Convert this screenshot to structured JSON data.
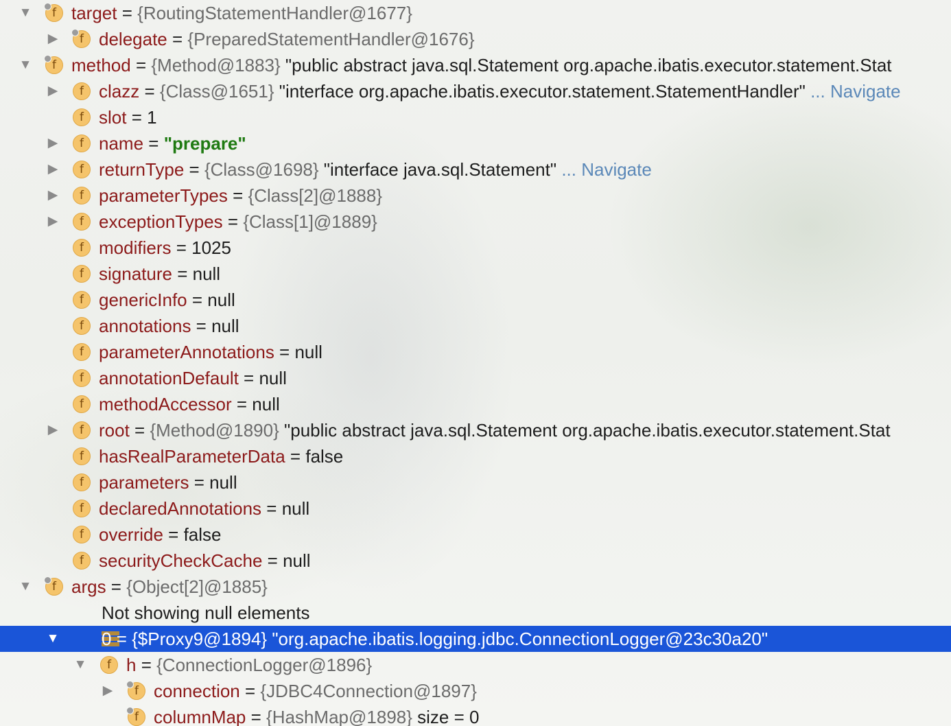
{
  "colors": {
    "selection": "#1a55d8",
    "field_name": "#8c1a1a",
    "type_ref": "#6b6b6b",
    "string_literal": "#1f7a12",
    "navigate_link": "#5b88b8",
    "field_icon": "#f5c46b"
  },
  "icons": {
    "field": "field-f-icon",
    "static_field": "field-f-pinned-icon",
    "array": "array-icon",
    "expanded": "triangle-down",
    "collapsed": "triangle-right"
  },
  "rows": [
    {
      "arrow": "▼",
      "icon": "f",
      "pinned": true,
      "name": "target",
      "eq": " = ",
      "type": "{RoutingStatementHandler@1677}",
      "value": "",
      "navigate": ""
    },
    {
      "arrow": "▶",
      "icon": "f",
      "pinned": true,
      "name": "delegate",
      "eq": " = ",
      "type": "{PreparedStatementHandler@1676}",
      "value": "",
      "navigate": ""
    },
    {
      "arrow": "▼",
      "icon": "f",
      "pinned": true,
      "name": "method",
      "eq": " = ",
      "type": "{Method@1883}",
      "value": " \"public abstract java.sql.Statement org.apache.ibatis.executor.statement.Stat",
      "navigate": ""
    },
    {
      "arrow": "▶",
      "icon": "f",
      "pinned": false,
      "name": "clazz",
      "eq": " = ",
      "type": "{Class@1651}",
      "value": " \"interface org.apache.ibatis.executor.statement.StatementHandler\"",
      "navigate": " ... Navigate"
    },
    {
      "arrow": "",
      "icon": "f",
      "pinned": false,
      "name": "slot",
      "eq": " = ",
      "type": "",
      "value": "1",
      "navigate": ""
    },
    {
      "arrow": "▶",
      "icon": "f",
      "pinned": false,
      "name": "name",
      "eq": " = ",
      "type": "",
      "value": "",
      "green": "\"prepare\"",
      "navigate": ""
    },
    {
      "arrow": "▶",
      "icon": "f",
      "pinned": false,
      "name": "returnType",
      "eq": " = ",
      "type": "{Class@1698}",
      "value": " \"interface java.sql.Statement\"",
      "navigate": " ... Navigate"
    },
    {
      "arrow": "▶",
      "icon": "f",
      "pinned": false,
      "name": "parameterTypes",
      "eq": " = ",
      "type": "{Class[2]@1888}",
      "value": "",
      "navigate": ""
    },
    {
      "arrow": "▶",
      "icon": "f",
      "pinned": false,
      "name": "exceptionTypes",
      "eq": " = ",
      "type": "{Class[1]@1889}",
      "value": "",
      "navigate": ""
    },
    {
      "arrow": "",
      "icon": "f",
      "pinned": false,
      "name": "modifiers",
      "eq": " = ",
      "type": "",
      "value": "1025",
      "navigate": ""
    },
    {
      "arrow": "",
      "icon": "f",
      "pinned": false,
      "name": "signature",
      "eq": " = ",
      "type": "",
      "value": "null",
      "navigate": ""
    },
    {
      "arrow": "",
      "icon": "f",
      "pinned": false,
      "name": "genericInfo",
      "eq": " = ",
      "type": "",
      "value": "null",
      "navigate": ""
    },
    {
      "arrow": "",
      "icon": "f",
      "pinned": false,
      "name": "annotations",
      "eq": " = ",
      "type": "",
      "value": "null",
      "navigate": ""
    },
    {
      "arrow": "",
      "icon": "f",
      "pinned": false,
      "name": "parameterAnnotations",
      "eq": " = ",
      "type": "",
      "value": "null",
      "navigate": ""
    },
    {
      "arrow": "",
      "icon": "f",
      "pinned": false,
      "name": "annotationDefault",
      "eq": " = ",
      "type": "",
      "value": "null",
      "navigate": ""
    },
    {
      "arrow": "",
      "icon": "f",
      "pinned": false,
      "name": "methodAccessor",
      "eq": " = ",
      "type": "",
      "value": "null",
      "navigate": ""
    },
    {
      "arrow": "▶",
      "icon": "f",
      "pinned": false,
      "name": "root",
      "eq": " = ",
      "type": "{Method@1890}",
      "value": " \"public abstract java.sql.Statement org.apache.ibatis.executor.statement.Stat",
      "navigate": ""
    },
    {
      "arrow": "",
      "icon": "f",
      "pinned": false,
      "name": "hasRealParameterData",
      "eq": " = ",
      "type": "",
      "value": "false",
      "navigate": ""
    },
    {
      "arrow": "",
      "icon": "f",
      "pinned": false,
      "name": "parameters",
      "eq": " = ",
      "type": "",
      "value": "null",
      "navigate": ""
    },
    {
      "arrow": "",
      "icon": "f",
      "pinned": false,
      "name": "declaredAnnotations",
      "eq": " = ",
      "type": "",
      "value": "null",
      "navigate": ""
    },
    {
      "arrow": "",
      "icon": "f",
      "pinned": false,
      "name": "override",
      "eq": " = ",
      "type": "",
      "value": "false",
      "navigate": ""
    },
    {
      "arrow": "",
      "icon": "f",
      "pinned": false,
      "name": "securityCheckCache",
      "eq": " = ",
      "type": "",
      "value": "null",
      "navigate": ""
    },
    {
      "arrow": "▼",
      "icon": "f",
      "pinned": true,
      "name": "args",
      "eq": " = ",
      "type": "{Object[2]@1885}",
      "value": "",
      "navigate": ""
    },
    {
      "arrow": "",
      "icon": "",
      "pinned": false,
      "name": "",
      "eq": "",
      "type": "",
      "value": "",
      "plain": "Not showing null elements",
      "navigate": ""
    },
    {
      "arrow": "▼",
      "icon": "array",
      "pinned": false,
      "name": "0",
      "eq": " = ",
      "type": "{$Proxy9@1894}",
      "value": " \"org.apache.ibatis.logging.jdbc.ConnectionLogger@23c30a20\"",
      "navigate": "",
      "selected": true
    },
    {
      "arrow": "▼",
      "icon": "f",
      "pinned": false,
      "name": "h",
      "eq": " = ",
      "type": "{ConnectionLogger@1896}",
      "value": "",
      "navigate": ""
    },
    {
      "arrow": "▶",
      "icon": "f",
      "pinned": true,
      "name": "connection",
      "eq": " = ",
      "type": "{JDBC4Connection@1897}",
      "value": "",
      "navigate": ""
    },
    {
      "arrow": "",
      "icon": "f",
      "pinned": true,
      "name": "columnMap",
      "eq": " = ",
      "type": "{HashMap@1898}",
      "value": "  size = 0",
      "navigate": ""
    }
  ]
}
